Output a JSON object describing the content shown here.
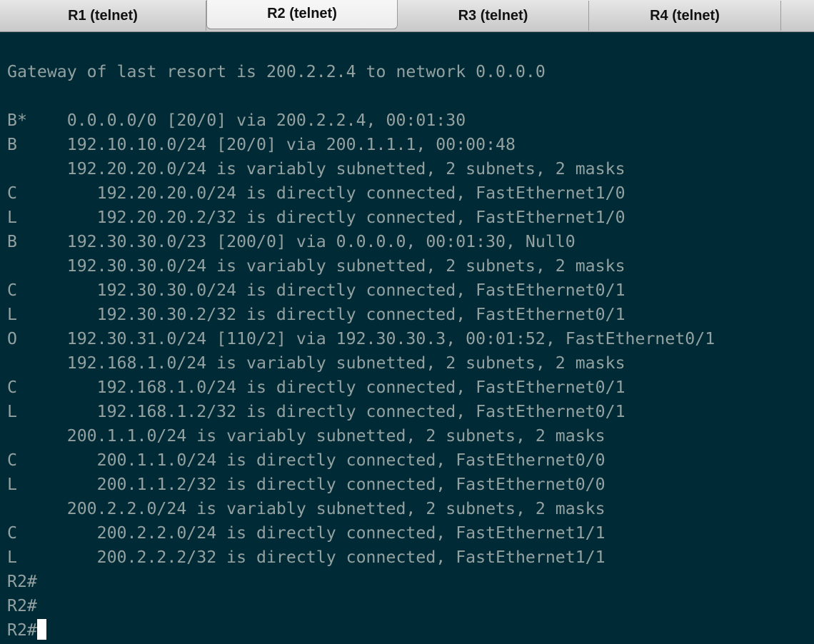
{
  "tabs": [
    {
      "label": "R1 (telnet)",
      "active": false
    },
    {
      "label": "R2 (telnet)",
      "active": true
    },
    {
      "label": "R3 (telnet)",
      "active": false
    },
    {
      "label": "R4 (telnet)",
      "active": false
    }
  ],
  "terminal": {
    "gateway_line": "Gateway of last resort is 200.2.2.4 to network 0.0.0.0",
    "routes": [
      "B*    0.0.0.0/0 [20/0] via 200.2.2.4, 00:01:30",
      "B     192.10.10.0/24 [20/0] via 200.1.1.1, 00:00:48",
      "      192.20.20.0/24 is variably subnetted, 2 subnets, 2 masks",
      "C        192.20.20.0/24 is directly connected, FastEthernet1/0",
      "L        192.20.20.2/32 is directly connected, FastEthernet1/0",
      "B     192.30.30.0/23 [200/0] via 0.0.0.0, 00:01:30, Null0",
      "      192.30.30.0/24 is variably subnetted, 2 subnets, 2 masks",
      "C        192.30.30.0/24 is directly connected, FastEthernet0/1",
      "L        192.30.30.2/32 is directly connected, FastEthernet0/1",
      "O     192.30.31.0/24 [110/2] via 192.30.30.3, 00:01:52, FastEthernet0/1",
      "      192.168.1.0/24 is variably subnetted, 2 subnets, 2 masks",
      "C        192.168.1.0/24 is directly connected, FastEthernet0/1",
      "L        192.168.1.2/32 is directly connected, FastEthernet0/1",
      "      200.1.1.0/24 is variably subnetted, 2 subnets, 2 masks",
      "C        200.1.1.0/24 is directly connected, FastEthernet0/0",
      "L        200.1.1.2/32 is directly connected, FastEthernet0/0",
      "      200.2.2.0/24 is variably subnetted, 2 subnets, 2 masks",
      "C        200.2.2.0/24 is directly connected, FastEthernet1/1",
      "L        200.2.2.2/32 is directly connected, FastEthernet1/1"
    ],
    "prompts": [
      "R2#",
      "R2#",
      "R2#"
    ],
    "colors": {
      "background": "#002b36",
      "text": "#93a1a1",
      "cursor": "#ffffff"
    }
  }
}
